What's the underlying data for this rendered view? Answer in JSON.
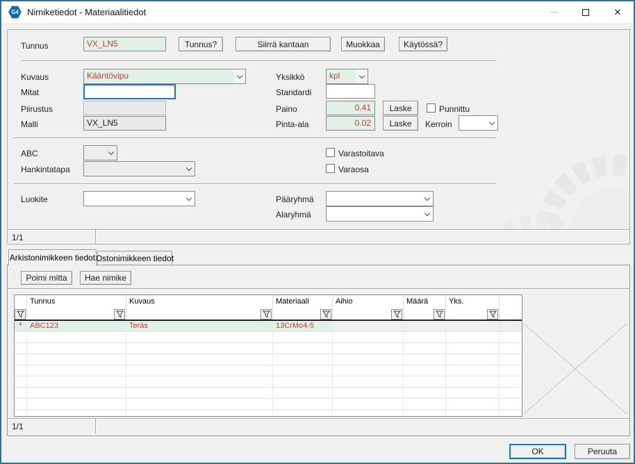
{
  "window": {
    "title": "Nimiketiedot - Materiaalitiedot",
    "icon": "G4",
    "controls": {
      "close": "✕"
    }
  },
  "toolbar": {
    "tunnus_label": "Tunnus",
    "tunnus_value": "VX_LN5",
    "tunnus_btn": "Tunnus?",
    "siirra_btn": "Siirrä kantaan",
    "muokkaa_btn": "Muokkaa",
    "kaytossa_btn": "Käytössä?"
  },
  "fields": {
    "kuvaus_label": "Kuvaus",
    "kuvaus_value": "Kääntövipu",
    "mitat_label": "Mitat",
    "mitat_value": "",
    "piirustus_label": "Piirustus",
    "piirustus_value": "",
    "malli_label": "Malli",
    "malli_value": "VX_LN5",
    "yksikko_label": "Yksikkö",
    "yksikko_value": "kpl",
    "standardi_label": "Standardi",
    "standardi_value": "",
    "paino_label": "Paino",
    "paino_value": "0.41",
    "pinta_label": "Pinta-ala",
    "pinta_value": "0.02",
    "laske_btn": "Laske",
    "punnittu_label": "Punnittu",
    "kerroin_label": "Kerroin",
    "abc_label": "ABC",
    "hankintatapa_label": "Hankintatapa",
    "varastoitava_label": "Varastoitava",
    "varaosa_label": "Varaosa",
    "luokite_label": "Luokite",
    "paaryhma_label": "Pääryhmä",
    "alaryhma_label": "Alaryhmä"
  },
  "form_pager": "1/1",
  "tabs": {
    "archive": "Arkistonimikkeen tiedot",
    "purchase": "Ostonimikkeen tiedot"
  },
  "tab_toolbar": {
    "poimi_btn": "Poimi mitta",
    "hae_btn": "Hae nimike"
  },
  "grid": {
    "columns": [
      "Tunnus",
      "Kuvaus",
      "Materiaali",
      "Aihio",
      "Määrä",
      "Yks."
    ],
    "row": {
      "marker": "*",
      "tunnus": "ABC123",
      "kuvaus": "Teräs",
      "materiaali": "13CrMo4-5",
      "aihio": "",
      "maara": "",
      "yks": ""
    }
  },
  "grid_pager": "1/1",
  "footer": {
    "ok_btn": "OK",
    "cancel_btn": "Peruuta"
  },
  "colors": {
    "field_green": "#e2f1e7",
    "value_red": "#c43c3c",
    "focus_blue": "#1177d2",
    "frame_teal": "#33708d"
  }
}
